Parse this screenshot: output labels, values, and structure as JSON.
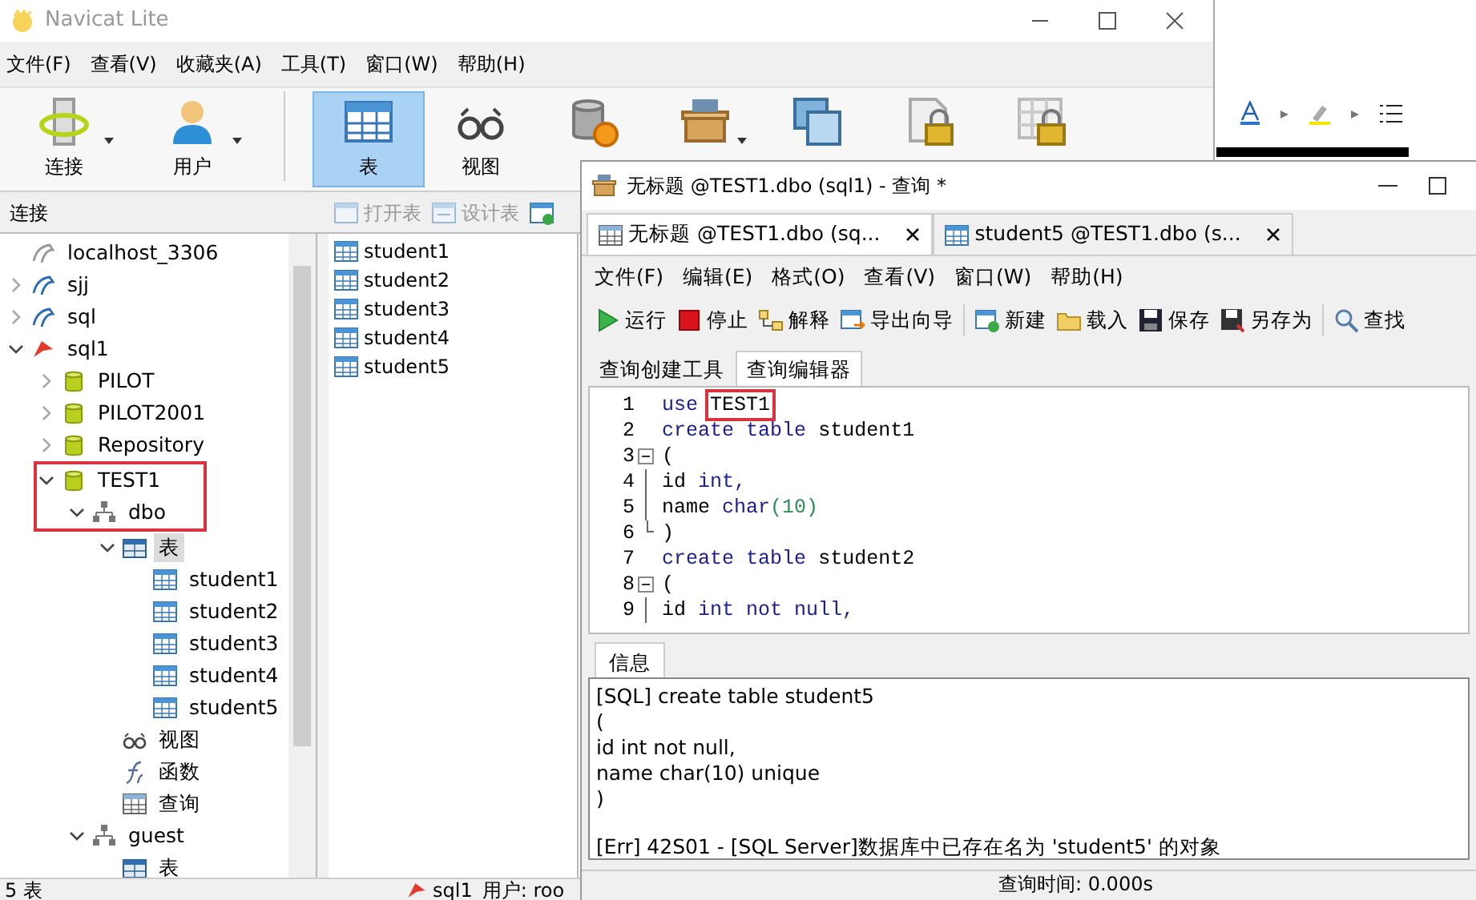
{
  "main_window": {
    "title": "Navicat Lite",
    "menu": [
      "文件(F)",
      "查看(V)",
      "收藏夹(A)",
      "工具(T)",
      "窗口(W)",
      "帮助(H)"
    ],
    "toolbar": [
      {
        "label": "连接",
        "dropdown": true,
        "selected": false
      },
      {
        "label": "用户",
        "dropdown": true,
        "selected": false
      },
      {
        "label": "表",
        "dropdown": false,
        "selected": true
      },
      {
        "label": "视图",
        "dropdown": false,
        "selected": false
      },
      {
        "dropdown": false,
        "selected": false
      },
      {
        "dropdown": true,
        "selected": false
      },
      {
        "dropdown": false,
        "selected": false
      },
      {
        "dropdown": false,
        "selected": false
      },
      {
        "dropdown": false,
        "selected": false
      }
    ],
    "panel_title": "连接",
    "object_toolbar": [
      "打开表",
      "设计表"
    ],
    "tree": [
      {
        "label": "localhost_3306",
        "kind": "conn-grey",
        "selected": false
      },
      {
        "label": "sjj",
        "kind": "conn-blue",
        "selected": false,
        "expanded": false
      },
      {
        "label": "sql",
        "kind": "conn-blue",
        "selected": false,
        "expanded": false
      },
      {
        "label": "sql1",
        "kind": "conn-red",
        "selected": false,
        "expanded": true,
        "children": [
          {
            "label": "PILOT",
            "kind": "database",
            "selected": false,
            "expanded": false
          },
          {
            "label": "PILOT2001",
            "kind": "database",
            "selected": false,
            "expanded": false
          },
          {
            "label": "Repository",
            "kind": "database",
            "selected": false,
            "expanded": false
          },
          {
            "label": "TEST1",
            "kind": "database",
            "selected": false,
            "expanded": true,
            "highlighted": true,
            "children": [
              {
                "label": "dbo",
                "kind": "schema",
                "selected": false,
                "expanded": true,
                "highlighted": true,
                "children": [
                  {
                    "label": "表",
                    "kind": "table-folder",
                    "selected": true,
                    "expanded": true,
                    "children": [
                      {
                        "label": "student1",
                        "kind": "table",
                        "selected": false
                      },
                      {
                        "label": "student2",
                        "kind": "table",
                        "selected": false
                      },
                      {
                        "label": "student3",
                        "kind": "table",
                        "selected": false
                      },
                      {
                        "label": "student4",
                        "kind": "table",
                        "selected": false
                      },
                      {
                        "label": "student5",
                        "kind": "table",
                        "selected": false
                      }
                    ]
                  },
                  {
                    "label": "视图",
                    "kind": "view",
                    "selected": false
                  },
                  {
                    "label": "函数",
                    "kind": "function",
                    "selected": false
                  },
                  {
                    "label": "查询",
                    "kind": "query",
                    "selected": false
                  }
                ]
              },
              {
                "label": "guest",
                "kind": "schema",
                "selected": false,
                "expanded": true,
                "children": [
                  {
                    "label": "表",
                    "kind": "table-folder",
                    "selected": false
                  }
                ]
              }
            ]
          }
        ]
      }
    ],
    "object_list": [
      "student1",
      "student2",
      "student3",
      "student4",
      "student5"
    ],
    "status_bar": [
      "5 表",
      "sql1",
      "用户: roo"
    ]
  },
  "query_window": {
    "title": "无标题 @TEST1.dbo (sql1) - 查询 *",
    "tabs": [
      {
        "label": "无标题 @TEST1.dbo (sq...",
        "selected": true
      },
      {
        "label": "student5 @TEST1.dbo (s...",
        "selected": false
      }
    ],
    "menu": [
      "文件(F)",
      "编辑(E)",
      "格式(O)",
      "查看(V)",
      "窗口(W)",
      "帮助(H)"
    ],
    "toolbar": [
      [
        "运行",
        "停止",
        "解释",
        "导出向导"
      ],
      [
        "新建",
        "载入",
        "保存",
        "另存为"
      ],
      [
        "查找"
      ]
    ],
    "editor_tabs": [
      {
        "label": "查询创建工具",
        "selected": false
      },
      {
        "label": "查询编辑器",
        "selected": true
      }
    ],
    "code": [
      {
        "number": "1",
        "kind": "plain",
        "tokens": [
          {
            "text": "use",
            "kind": "keyword"
          },
          {
            "text": "TEST1",
            "kind": "plain",
            "highlighted": true
          }
        ]
      },
      {
        "number": "2",
        "kind": "plain",
        "tokens": [
          {
            "text": "create",
            "kind": "keyword"
          },
          {
            "text": "table",
            "kind": "keyword"
          },
          {
            "text": "student1",
            "kind": "plain"
          }
        ]
      },
      {
        "number": "3",
        "kind": "fold-start",
        "tokens": [
          {
            "text": "(",
            "kind": "plain"
          }
        ]
      },
      {
        "number": "4",
        "kind": "fold-body",
        "tokens": [
          {
            "text": "id",
            "kind": "plain"
          },
          {
            "text": "int,",
            "kind": "keyword"
          }
        ]
      },
      {
        "number": "5",
        "kind": "fold-body",
        "tokens": [
          {
            "text": "name",
            "kind": "plain"
          },
          {
            "text": "char",
            "kind": "keyword"
          },
          {
            "text": "(10)",
            "kind": "number"
          }
        ]
      },
      {
        "number": "6",
        "kind": "fold-end",
        "tokens": [
          {
            "text": ")",
            "kind": "plain"
          }
        ]
      },
      {
        "number": "7",
        "kind": "plain",
        "tokens": [
          {
            "text": "create",
            "kind": "keyword"
          },
          {
            "text": "table",
            "kind": "keyword"
          },
          {
            "text": "student2",
            "kind": "plain"
          }
        ]
      },
      {
        "number": "8",
        "kind": "fold-start",
        "tokens": [
          {
            "text": "(",
            "kind": "plain"
          }
        ]
      },
      {
        "number": "9",
        "kind": "fold-body",
        "tokens": [
          {
            "text": "id",
            "kind": "plain"
          },
          {
            "text": "int not null,",
            "kind": "keyword"
          }
        ]
      }
    ],
    "result_tabs": [
      {
        "label": "信息",
        "selected": true
      }
    ],
    "messages": [
      [
        "[SQL] create table student5",
        "(",
        "id int not null,",
        "name char(10) unique",
        ")"
      ],
      [
        "[Err] 42S01 - [SQL Server]数据库中已存在名为 'student5' 的对象"
      ]
    ],
    "status_bar": [
      "查询时间: 0.000s"
    ]
  }
}
